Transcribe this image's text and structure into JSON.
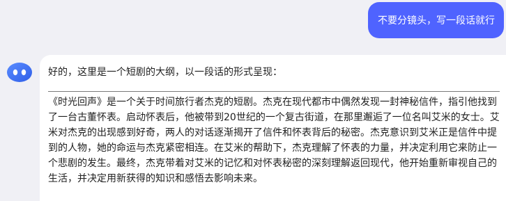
{
  "user_message": {
    "text": "不要分镜头，写一段话就行"
  },
  "assistant_message": {
    "intro": "好的，这里是一个短剧的大纲，以一段话的形式呈现：",
    "story": "《时光回声》是一个关于时间旅行者杰克的短剧。杰克在现代都市中偶然发现一封神秘信件，指引他找到了一台古董怀表。启动怀表后，他被带到20世纪的一个复古街道，在那里邂逅了一位名叫艾米的女士。艾米对杰克的出现感到好奇，两人的对话逐渐揭开了信件和怀表背后的秘密。杰克意识到艾米正是信件中提到的人物，她的命运与杰克紧密相连。在艾米的帮助下，杰克理解了怀表的力量，并决定利用它来防止一个悲剧的发生。最终，杰克带着对艾米的记忆和对怀表秘密的深刻理解返回现代，他开始重新审视自己的生活，并决定用新获得的知识和感悟去影响未来。"
  },
  "colors": {
    "page_background": "#f0f0f5",
    "user_bubble": "#4f63ff",
    "assistant_card": "#ffffff",
    "avatar": "#3b6ff5"
  },
  "icons": {
    "assistant_avatar": "robot-face-icon"
  }
}
